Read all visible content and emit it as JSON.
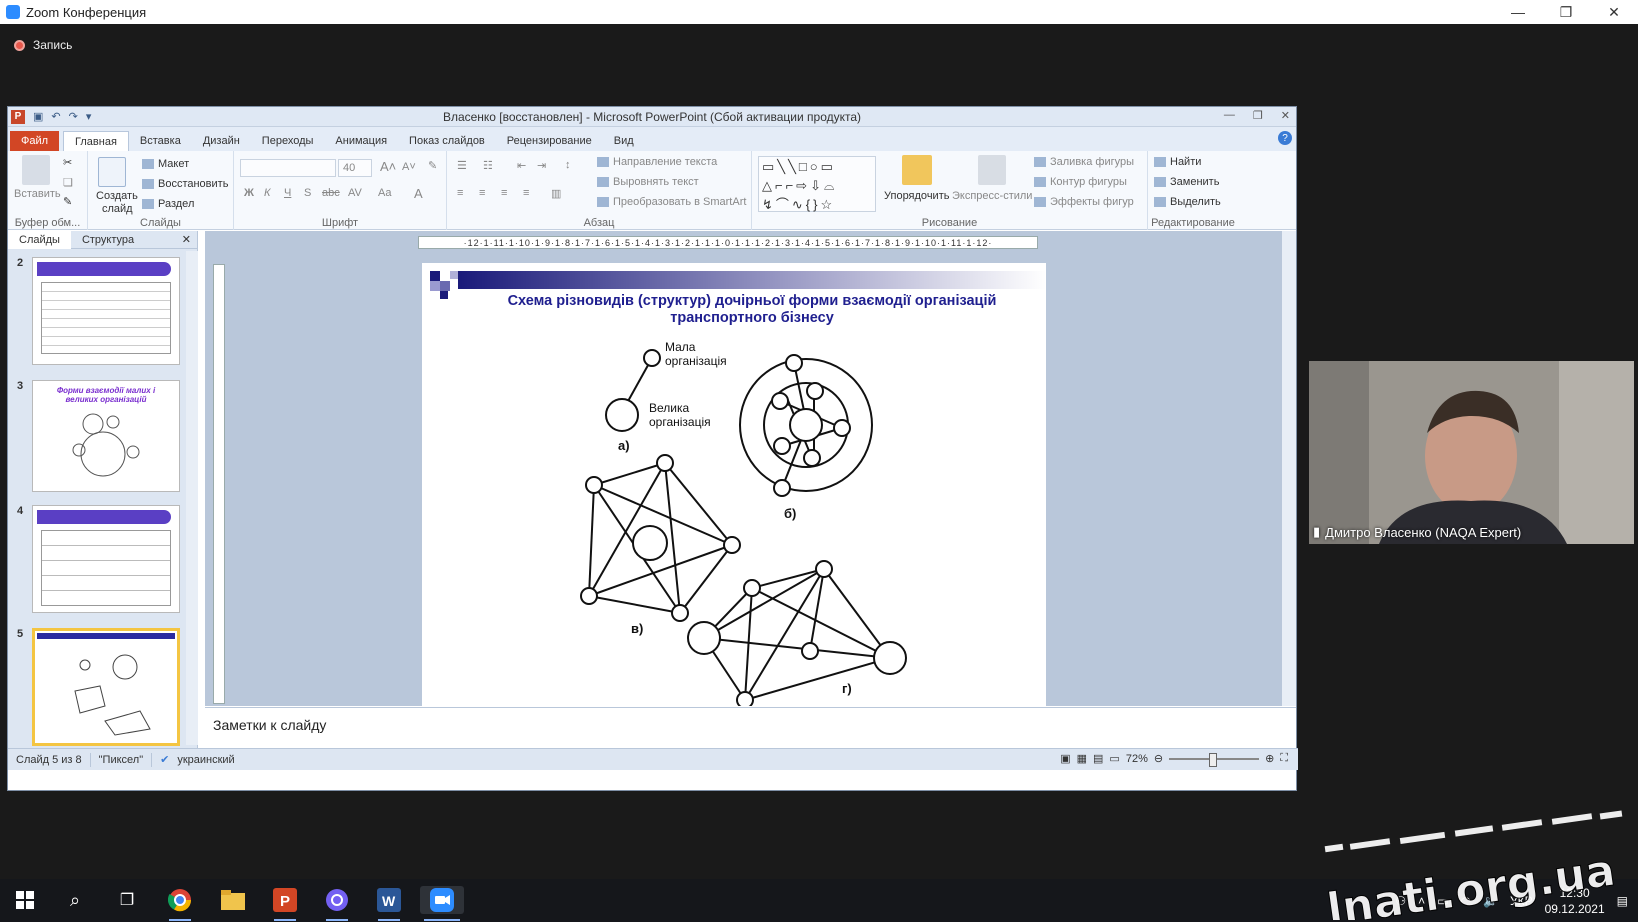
{
  "zoom": {
    "window_title": "Zoom Конференция",
    "recording_label": "Запись"
  },
  "ppt": {
    "window_title": "Власенко [восстановлен]  -  Microsoft PowerPoint (Сбой активации продукта)",
    "tabs": [
      {
        "label": "Файл"
      },
      {
        "label": "Главная"
      },
      {
        "label": "Вставка"
      },
      {
        "label": "Дизайн"
      },
      {
        "label": "Переходы"
      },
      {
        "label": "Анимация"
      },
      {
        "label": "Показ слайдов"
      },
      {
        "label": "Рецензирование"
      },
      {
        "label": "Вид"
      }
    ],
    "ribbon": {
      "clipboard": {
        "paste": "Вставить",
        "label": "Буфер обм..."
      },
      "slides": {
        "new_slide_1": "Создать",
        "new_slide_2": "слайд",
        "layout": "Макет",
        "reset": "Восстановить",
        "section": "Раздел",
        "label": "Слайды"
      },
      "font": {
        "size": "40",
        "label": "Шрифт",
        "bold": "Ж",
        "italic": "К",
        "underline": "Ч",
        "strike": "abc",
        "spacing": "AV",
        "case": "Aa",
        "color": "A",
        "shadow": "S"
      },
      "paragraph": {
        "text_direction": "Направление текста",
        "align_text": "Выровнять текст",
        "smartart": "Преобразовать в SmartArt",
        "label": "Абзац"
      },
      "drawing": {
        "arrange": "Упорядочить",
        "quick_styles": "Экспресс-стили",
        "fill": "Заливка фигуры",
        "outline": "Контур фигуры",
        "effects": "Эффекты фигур",
        "label": "Рисование"
      },
      "editing": {
        "find": "Найти",
        "replace": "Заменить",
        "select": "Выделить",
        "label": "Редактирование"
      }
    },
    "panel_tabs": {
      "slides": "Слайды",
      "outline": "Структура",
      "close": "✕"
    },
    "thumbnails": [
      {
        "num": "2"
      },
      {
        "num": "3",
        "title": "Форми взаємодії малих і великих організацій"
      },
      {
        "num": "4"
      },
      {
        "num": "5"
      }
    ],
    "ruler": "·12·1·11·1·10·1·9·1·8·1·7·1·6·1·5·1·4·1·3·1·2·1·1·1·0·1·1·1·2·1·3·1·4·1·5·1·6·1·7·1·8·1·9·1·10·1·11·1·12·",
    "slide": {
      "title": "Схема різновидів  (структур)  дочірньої  форми  взаємодії  організацій транспортного  бізнесу",
      "small_org_1": "Мала",
      "small_org_2": "організація",
      "large_org_1": "Велика",
      "large_org_2": "організація",
      "label_a": "а)",
      "label_b": "б)",
      "label_v": "в)",
      "label_g": "г)"
    },
    "notes_placeholder": "Заметки к слайду",
    "status": {
      "slide": "Слайд 5 из 8",
      "theme": "\"Пиксел\"",
      "language": "украинский",
      "zoom": "72%"
    }
  },
  "video": {
    "participant": "Дмитро Власенко (NAQA Expert)"
  },
  "taskbar": {
    "language": "УКР",
    "time": "12:30",
    "date": "09.12.2021"
  },
  "colors": {
    "slide_title": "#1f1f8f",
    "accent": "#d24625",
    "taskbar_active": "#8ab4f8"
  }
}
